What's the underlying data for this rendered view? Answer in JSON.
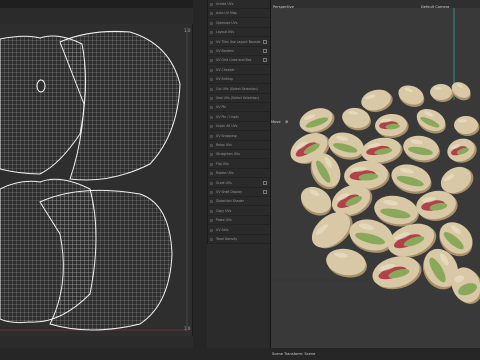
{
  "uv_editor": {
    "tick_right_top": "1.0",
    "tick_right_bottom": "1.0"
  },
  "menu_panel": {
    "items": [
      {
        "label": "Unfold UVs",
        "checkbox": false
      },
      {
        "label": "Auto UV Map",
        "checkbox": false
      },
      {
        "label": "Optimize UVs",
        "checkbox": false
      },
      {
        "label": "Layout UVs",
        "checkbox": false
      },
      {
        "label": "UV Tiles Use Layout Bounds",
        "checkbox": true
      },
      {
        "label": "UV Borders",
        "checkbox": true
      },
      {
        "label": "UV Grid Lines and Box",
        "checkbox": true
      },
      {
        "label": "UV Checker",
        "checkbox": false
      },
      {
        "label": "UV Editing",
        "checkbox": false
      },
      {
        "label": "Cut UVs (Select Selection)",
        "checkbox": false
      },
      {
        "label": "Sew UVs (Select Selection)",
        "checkbox": false
      },
      {
        "label": "UV Pin",
        "checkbox": false
      },
      {
        "label": "UV Pin / Unpin",
        "checkbox": false
      },
      {
        "label": "Unpin All UVs",
        "checkbox": false
      },
      {
        "label": "UV Snapping",
        "checkbox": false
      },
      {
        "label": "Relax UVs",
        "checkbox": false
      },
      {
        "label": "Straighten UVs",
        "checkbox": false
      },
      {
        "label": "Flip UVs",
        "checkbox": false
      },
      {
        "label": "Rotate UVs",
        "checkbox": false
      },
      {
        "label": "Scale UVs",
        "checkbox": true
      },
      {
        "label": "UV Shell Display",
        "checkbox": true
      },
      {
        "label": "Distortion Shader",
        "checkbox": false
      },
      {
        "label": "Copy UVs",
        "checkbox": false
      },
      {
        "label": "Paste UVs",
        "checkbox": false
      },
      {
        "label": "UV Sets",
        "checkbox": false
      },
      {
        "label": "Texel Density",
        "checkbox": false
      }
    ]
  },
  "viewport": {
    "perspective_label": "Perspective",
    "camera_label": "Default Camera",
    "mode_label": "Move",
    "status_text": "Scene Transform: Scene"
  },
  "colors": {
    "uv_wire": "#e8e8e8",
    "uv_bg": "#2e2e2e",
    "viewport_bg": "#393939",
    "pistachio_shell": "#d8c8a6",
    "pistachio_shade": "#a8916a",
    "pistachio_nut": "#8aa85a",
    "pistachio_skin": "#b0404a",
    "camera_line": "#2aa79b"
  }
}
